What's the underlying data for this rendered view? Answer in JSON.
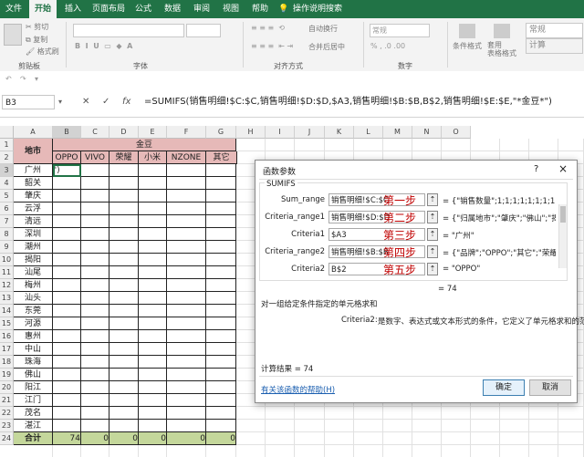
{
  "ribbon": {
    "tabs": [
      "文件",
      "开始",
      "插入",
      "页面布局",
      "公式",
      "数据",
      "审阅",
      "视图",
      "帮助",
      "操作说明搜索"
    ],
    "clipboard": {
      "cut": "剪切",
      "copy": "复制",
      "format_painter": "格式刷",
      "label": "剪贴板"
    },
    "font_label": "字体",
    "alignment": {
      "wrap": "自动换行",
      "merge": "合并后居中",
      "label": "对齐方式"
    },
    "number": {
      "format": "常规",
      "label": "数字"
    },
    "styles": {
      "conditional": "条件格式",
      "table": "套用\n表格格式",
      "normal": "常规",
      "calc": "计算"
    }
  },
  "formula_bar": {
    "name_box": "B3",
    "formula": "=SUMIFS(销售明细!$C:$C,销售明细!$D:$D,$A3,销售明细!$B:$B,B$2,销售明细!$E:$E,\"*金豆*\")"
  },
  "sheet": {
    "columns": [
      "A",
      "B",
      "C",
      "D",
      "E",
      "F",
      "G",
      "H",
      "I",
      "J",
      "K",
      "L",
      "M",
      "N",
      "O"
    ],
    "rows": [
      "1",
      "2",
      "3",
      "4",
      "5",
      "6",
      "7",
      "8",
      "9",
      "10",
      "11",
      "12",
      "13",
      "14",
      "15",
      "16",
      "17",
      "18",
      "19",
      "20",
      "21",
      "22",
      "23",
      "24"
    ],
    "header_city": "地市",
    "header_group": "金豆",
    "brands": [
      "OPPO",
      "VIVO",
      "荣耀",
      "小米",
      "NZONE",
      "其它"
    ],
    "cities": [
      "广州",
      "韶关",
      "肇庆",
      "云浮",
      "清远",
      "深圳",
      "潮州",
      "揭阳",
      "汕尾",
      "梅州",
      "汕头",
      "东莞",
      "河源",
      "惠州",
      "中山",
      "珠海",
      "佛山",
      "阳江",
      "江门",
      "茂名",
      "湛江"
    ],
    "b3_partial": "\")",
    "total_label": "合计",
    "totals": [
      "74",
      "0",
      "0",
      "0",
      "0",
      "0"
    ]
  },
  "dialog": {
    "title": "函数参数",
    "help_btn": "?",
    "close_btn": "×",
    "func": "SUMIFS",
    "args": [
      {
        "label": "Sum_range",
        "value": "销售明细!$C:$C",
        "step": "第一步",
        "result": "= {\"销售数量\";1;1;1;1;1;1;1;1;1;1;1"
      },
      {
        "label": "Criteria_range1",
        "value": "销售明细!$D:$D",
        "step": "第二步",
        "result": "= {\"归属地市\";\"肇庆\";\"佛山\";\"揭阳"
      },
      {
        "label": "Criteria1",
        "value": "$A3",
        "step": "第三步",
        "result": "= \"广州\""
      },
      {
        "label": "Criteria_range2",
        "value": "销售明细!$B:$B",
        "step": "第四步",
        "result": "= {\"品牌\";\"OPPO\";\"其它\";\"荣耀\";\""
      },
      {
        "label": "Criteria2",
        "value": "B$2",
        "step": "第五步",
        "result": "= \"OPPO\""
      }
    ],
    "equals_result": "= 74",
    "description": "对一组给定条件指定的单元格求和",
    "arg_help_label": "Criteria2:",
    "arg_help": "是数字、表达式或文本形式的条件，它定义了单元格求和的范围",
    "calc_result": "计算结果 =   74",
    "help_link": "有关该函数的帮助(H)",
    "ok": "确定",
    "cancel": "取消"
  }
}
